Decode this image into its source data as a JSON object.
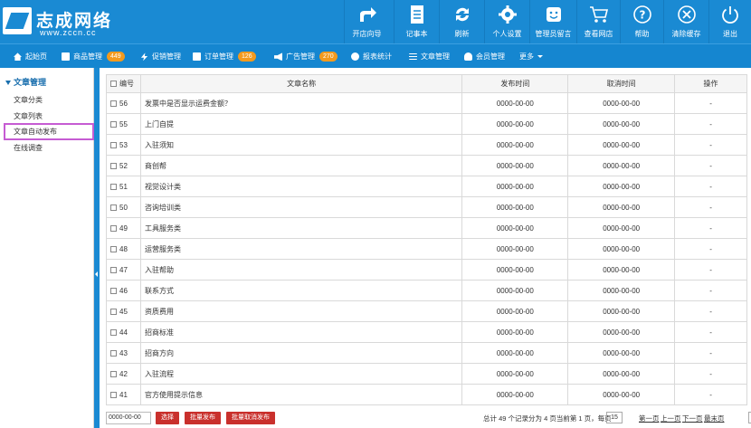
{
  "logo": {
    "cn": "志成网络",
    "en": "www.zccn.cc"
  },
  "toolbar": [
    {
      "label": "开店向导",
      "icon": "share-arrow-icon"
    },
    {
      "label": "记事本",
      "icon": "notebook-icon"
    },
    {
      "label": "刷新",
      "icon": "refresh-icon"
    },
    {
      "label": "个人设置",
      "icon": "gear-icon"
    },
    {
      "label": "管理员留言",
      "icon": "message-smile-icon"
    },
    {
      "label": "查看网店",
      "icon": "cart-icon"
    },
    {
      "label": "帮助",
      "icon": "help-icon"
    },
    {
      "label": "清除缓存",
      "icon": "clear-x-icon"
    },
    {
      "label": "退出",
      "icon": "power-icon"
    }
  ],
  "nav": {
    "home": "起始页",
    "goods": "商品管理",
    "goods_badge": "449",
    "promo": "促销管理",
    "orders": "订单管理",
    "orders_badge": "126",
    "ads": "广告管理",
    "ads_badge": "270",
    "stats": "报表统计",
    "articles": "文章管理",
    "members": "会员管理",
    "more": "更多"
  },
  "sidebar": {
    "title": "文章管理",
    "items": [
      "文章分类",
      "文章列表",
      "文章自动发布",
      "在线调查"
    ]
  },
  "table": {
    "headers": {
      "id": "编号",
      "name": "文章名称",
      "publish": "发布时间",
      "cancel": "取消时间",
      "op": "操作"
    },
    "rows": [
      {
        "id": "56",
        "name": "发票中是否显示运费金额？",
        "publish": "0000-00-00",
        "cancel": "0000-00-00",
        "op": "-"
      },
      {
        "id": "55",
        "name": "上门自提",
        "publish": "0000-00-00",
        "cancel": "0000-00-00",
        "op": "-"
      },
      {
        "id": "53",
        "name": "入驻须知",
        "publish": "0000-00-00",
        "cancel": "0000-00-00",
        "op": "-"
      },
      {
        "id": "52",
        "name": "商创帮",
        "publish": "0000-00-00",
        "cancel": "0000-00-00",
        "op": "-"
      },
      {
        "id": "51",
        "name": "视觉设计类",
        "publish": "0000-00-00",
        "cancel": "0000-00-00",
        "op": "-"
      },
      {
        "id": "50",
        "name": "咨询培训类",
        "publish": "0000-00-00",
        "cancel": "0000-00-00",
        "op": "-"
      },
      {
        "id": "49",
        "name": "工具服务类",
        "publish": "0000-00-00",
        "cancel": "0000-00-00",
        "op": "-"
      },
      {
        "id": "48",
        "name": "运营服务类",
        "publish": "0000-00-00",
        "cancel": "0000-00-00",
        "op": "-"
      },
      {
        "id": "47",
        "name": "入驻帮助",
        "publish": "0000-00-00",
        "cancel": "0000-00-00",
        "op": "-"
      },
      {
        "id": "46",
        "name": "联系方式",
        "publish": "0000-00-00",
        "cancel": "0000-00-00",
        "op": "-"
      },
      {
        "id": "45",
        "name": "资质费用",
        "publish": "0000-00-00",
        "cancel": "0000-00-00",
        "op": "-"
      },
      {
        "id": "44",
        "name": "招商标准",
        "publish": "0000-00-00",
        "cancel": "0000-00-00",
        "op": "-"
      },
      {
        "id": "43",
        "name": "招商方向",
        "publish": "0000-00-00",
        "cancel": "0000-00-00",
        "op": "-"
      },
      {
        "id": "42",
        "name": "入驻流程",
        "publish": "0000-00-00",
        "cancel": "0000-00-00",
        "op": "-"
      },
      {
        "id": "41",
        "name": "官方使用提示信息",
        "publish": "0000-00-00",
        "cancel": "0000-00-00",
        "op": "-"
      }
    ]
  },
  "footer": {
    "date_value": "0000-00-00",
    "btn_select": "选择",
    "btn_batch_publish": "批量发布",
    "btn_batch_cancel": "批量取消发布",
    "info": "总计 49 个记录分为 4 页当前第 1 页，每页",
    "per_page": "15",
    "first": "第一页",
    "prev": "上一页",
    "next": "下一页",
    "last": "最末页",
    "page_select": "1"
  },
  "colors": {
    "primary": "#1a8ad3",
    "nav": "#1586d0",
    "badge": "#f39a1e",
    "danger": "#c9302c",
    "highlight": "#c65cd3"
  }
}
